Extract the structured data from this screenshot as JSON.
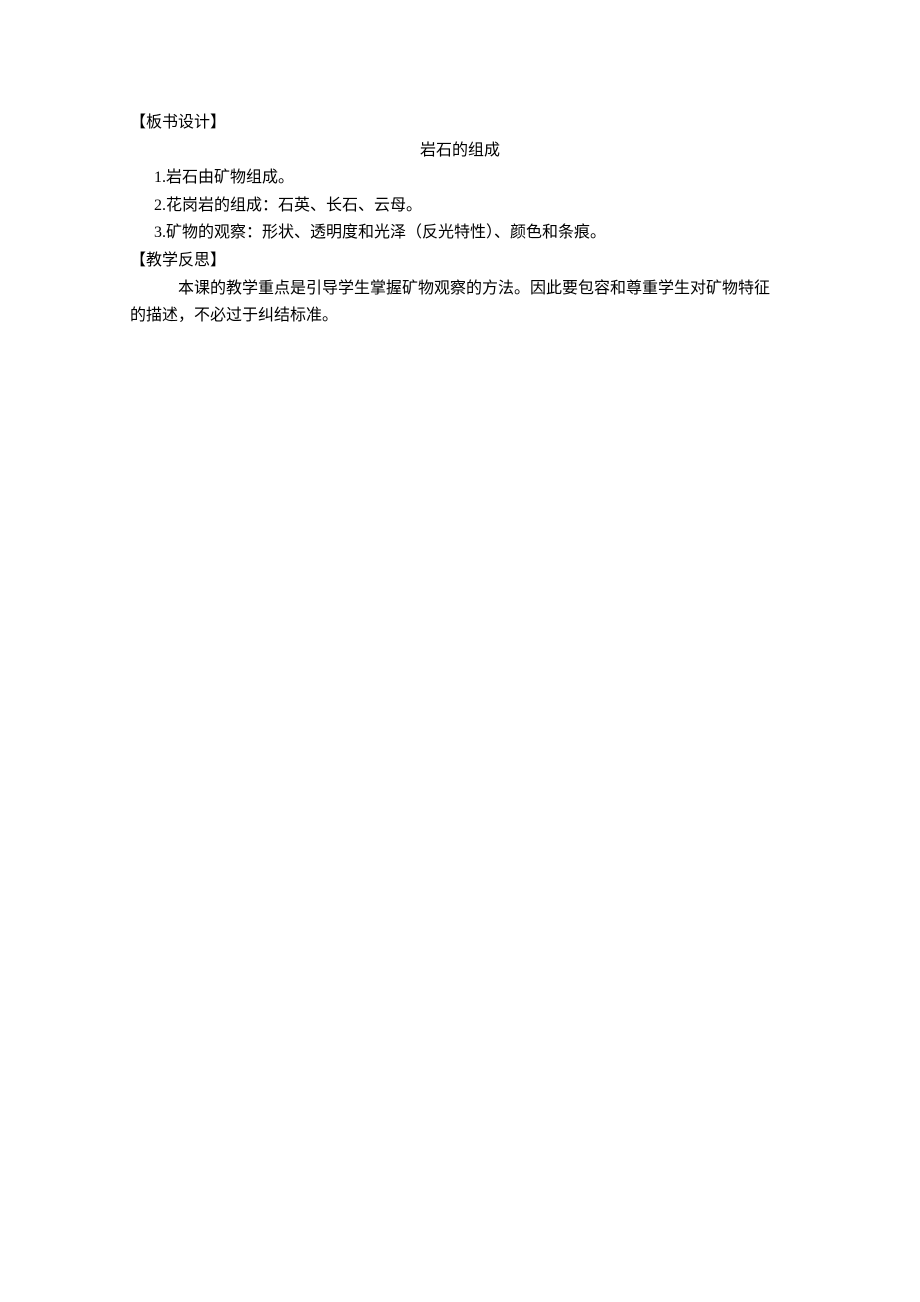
{
  "section1": {
    "header": "【板书设计】",
    "title": "岩石的组成",
    "items": [
      "1.岩石由矿物组成。",
      "2.花岗岩的组成：石英、长石、云母。",
      "3.矿物的观察：形状、透明度和光泽（反光特性）、颜色和条痕。"
    ]
  },
  "section2": {
    "header": "【教学反思】",
    "body_line1": "本课的教学重点是引导学生掌握矿物观察的方法。因此要包容和尊重学生对矿物特征",
    "body_line2": "的描述，不必过于纠结标准。"
  }
}
